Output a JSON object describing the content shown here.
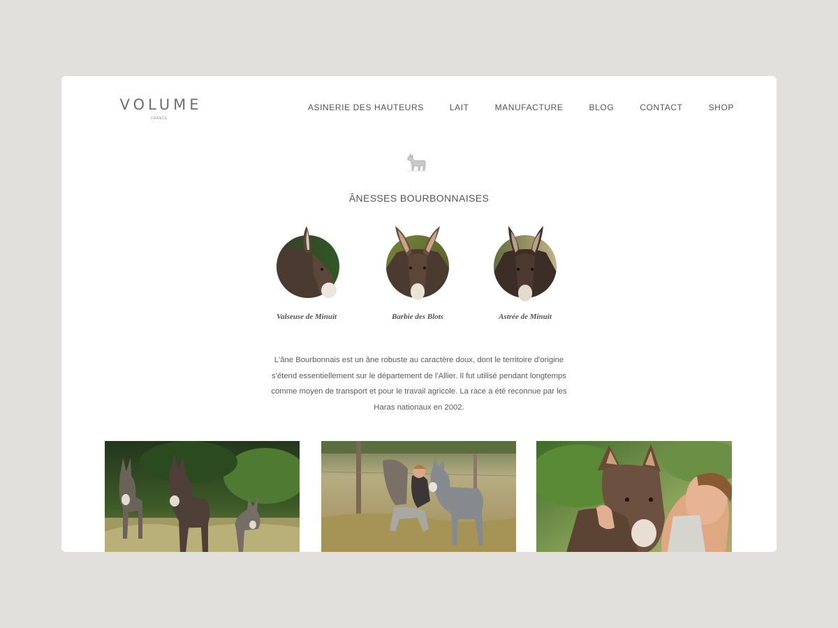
{
  "brand": {
    "logo_main": "VOLUME",
    "logo_sub": "FRANCE"
  },
  "nav": {
    "items": [
      {
        "label": "ASINERIE DES HAUTEURS"
      },
      {
        "label": "LAIT"
      },
      {
        "label": "MANUFACTURE"
      },
      {
        "label": "BLOG"
      },
      {
        "label": "CONTACT"
      },
      {
        "label": "SHOP"
      }
    ]
  },
  "hero": {
    "icon": "donkey-icon",
    "title": "ÂNESSES BOURBONNAISES"
  },
  "donkeys": [
    {
      "name": "Valseuse de Minuit"
    },
    {
      "name": "Barbie des Blots"
    },
    {
      "name": "Astrée de Minuit"
    }
  ],
  "description": "L'âne Bourbonnais est un âne robuste au caractère doux, dont le territoire d'origine s'étend essentiellement sur le département de l'Allier. Il fut utilisé pendant longtemps comme moyen de transport et pour le travail agricole. La race a été reconnue par les Haras nationaux en 2002.",
  "colors": {
    "background": "#e1e0dd",
    "card": "#ffffff",
    "text": "#555555"
  }
}
